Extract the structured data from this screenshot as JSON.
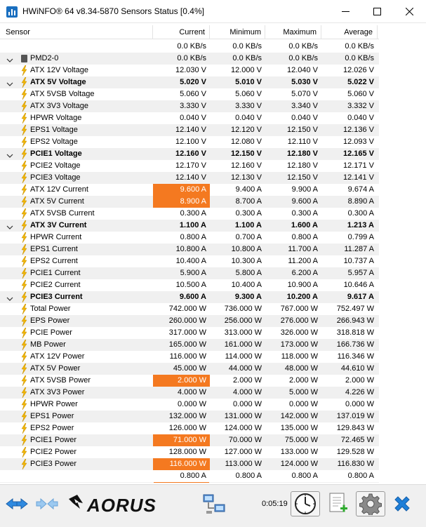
{
  "window": {
    "title": "HWiNFO® 64 v8.34-5870 Sensors Status [0.4%]"
  },
  "columns": {
    "sensor": "Sensor",
    "current": "Current",
    "minimum": "Minimum",
    "maximum": "Maximum",
    "average": "Average"
  },
  "rows": [
    {
      "type": "value",
      "label": "",
      "cur": "0.0 KB/s",
      "min": "0.0 KB/s",
      "max": "0.0 KB/s",
      "avg": "0.0 KB/s"
    },
    {
      "type": "device",
      "label": "PMD2-0",
      "cur": "0.0 KB/s",
      "min": "0.0 KB/s",
      "max": "0.0 KB/s",
      "avg": "0.0 KB/s"
    },
    {
      "type": "sensor",
      "label": "ATX 12V Voltage",
      "cur": "12.030 V",
      "min": "12.000 V",
      "max": "12.040 V",
      "avg": "12.026 V"
    },
    {
      "type": "group",
      "label": "ATX 5V Voltage",
      "cur": "5.020 V",
      "min": "5.010 V",
      "max": "5.030 V",
      "avg": "5.022 V"
    },
    {
      "type": "sensor",
      "label": "ATX 5VSB Voltage",
      "cur": "5.060 V",
      "min": "5.060 V",
      "max": "5.070 V",
      "avg": "5.060 V"
    },
    {
      "type": "sensor",
      "label": "ATX 3V3 Voltage",
      "cur": "3.330 V",
      "min": "3.330 V",
      "max": "3.340 V",
      "avg": "3.332 V"
    },
    {
      "type": "sensor",
      "label": "HPWR Voltage",
      "cur": "0.040 V",
      "min": "0.040 V",
      "max": "0.040 V",
      "avg": "0.040 V"
    },
    {
      "type": "sensor",
      "label": "EPS1 Voltage",
      "cur": "12.140 V",
      "min": "12.120 V",
      "max": "12.150 V",
      "avg": "12.136 V"
    },
    {
      "type": "sensor",
      "label": "EPS2 Voltage",
      "cur": "12.100 V",
      "min": "12.080 V",
      "max": "12.110 V",
      "avg": "12.093 V"
    },
    {
      "type": "group",
      "label": "PCIE1 Voltage",
      "cur": "12.160 V",
      "min": "12.150 V",
      "max": "12.180 V",
      "avg": "12.165 V"
    },
    {
      "type": "sensor",
      "label": "PCIE2 Voltage",
      "cur": "12.170 V",
      "min": "12.160 V",
      "max": "12.180 V",
      "avg": "12.171 V"
    },
    {
      "type": "sensor",
      "label": "PCIE3 Voltage",
      "cur": "12.140 V",
      "min": "12.130 V",
      "max": "12.150 V",
      "avg": "12.141 V"
    },
    {
      "type": "sensor",
      "label": "ATX 12V Current",
      "cur": "9.600 A",
      "min": "9.400 A",
      "max": "9.900 A",
      "avg": "9.674 A",
      "highlight": true
    },
    {
      "type": "sensor",
      "label": "ATX 5V Current",
      "cur": "8.900 A",
      "min": "8.700 A",
      "max": "9.600 A",
      "avg": "8.890 A",
      "highlight": true
    },
    {
      "type": "sensor",
      "label": "ATX 5VSB Current",
      "cur": "0.300 A",
      "min": "0.300 A",
      "max": "0.300 A",
      "avg": "0.300 A"
    },
    {
      "type": "group",
      "label": "ATX 3V Current",
      "cur": "1.100 A",
      "min": "1.100 A",
      "max": "1.600 A",
      "avg": "1.213 A"
    },
    {
      "type": "sensor",
      "label": "HPWR Current",
      "cur": "0.800 A",
      "min": "0.700 A",
      "max": "0.800 A",
      "avg": "0.799 A"
    },
    {
      "type": "sensor",
      "label": "EPS1 Current",
      "cur": "10.800 A",
      "min": "10.800 A",
      "max": "11.700 A",
      "avg": "11.287 A"
    },
    {
      "type": "sensor",
      "label": "EPS2 Current",
      "cur": "10.400 A",
      "min": "10.300 A",
      "max": "11.200 A",
      "avg": "10.737 A"
    },
    {
      "type": "sensor",
      "label": "PCIE1 Current",
      "cur": "5.900 A",
      "min": "5.800 A",
      "max": "6.200 A",
      "avg": "5.957 A"
    },
    {
      "type": "sensor",
      "label": "PCIE2 Current",
      "cur": "10.500 A",
      "min": "10.400 A",
      "max": "10.900 A",
      "avg": "10.646 A"
    },
    {
      "type": "group",
      "label": "PCIE3 Current",
      "cur": "9.600 A",
      "min": "9.300 A",
      "max": "10.200 A",
      "avg": "9.617 A"
    },
    {
      "type": "sensor",
      "label": "Total Power",
      "cur": "742.000 W",
      "min": "736.000 W",
      "max": "767.000 W",
      "avg": "752.497 W"
    },
    {
      "type": "sensor",
      "label": "EPS Power",
      "cur": "260.000 W",
      "min": "256.000 W",
      "max": "276.000 W",
      "avg": "266.943 W"
    },
    {
      "type": "sensor",
      "label": "PCIE Power",
      "cur": "317.000 W",
      "min": "313.000 W",
      "max": "326.000 W",
      "avg": "318.818 W"
    },
    {
      "type": "sensor",
      "label": "MB Power",
      "cur": "165.000 W",
      "min": "161.000 W",
      "max": "173.000 W",
      "avg": "166.736 W"
    },
    {
      "type": "sensor",
      "label": "ATX 12V Power",
      "cur": "116.000 W",
      "min": "114.000 W",
      "max": "118.000 W",
      "avg": "116.346 W"
    },
    {
      "type": "sensor",
      "label": "ATX 5V Power",
      "cur": "45.000 W",
      "min": "44.000 W",
      "max": "48.000 W",
      "avg": "44.610 W"
    },
    {
      "type": "sensor",
      "label": "ATX 5VSB Power",
      "cur": "2.000 W",
      "min": "2.000 W",
      "max": "2.000 W",
      "avg": "2.000 W",
      "highlight": true
    },
    {
      "type": "sensor",
      "label": "ATX 3V3 Power",
      "cur": "4.000 W",
      "min": "4.000 W",
      "max": "5.000 W",
      "avg": "4.226 W"
    },
    {
      "type": "sensor",
      "label": "HPWR Power",
      "cur": "0.000 W",
      "min": "0.000 W",
      "max": "0.000 W",
      "avg": "0.000 W"
    },
    {
      "type": "sensor",
      "label": "EPS1 Power",
      "cur": "132.000 W",
      "min": "131.000 W",
      "max": "142.000 W",
      "avg": "137.019 W"
    },
    {
      "type": "sensor",
      "label": "EPS2 Power",
      "cur": "126.000 W",
      "min": "124.000 W",
      "max": "135.000 W",
      "avg": "129.843 W"
    },
    {
      "type": "sensor",
      "label": "PCIE1 Power",
      "cur": "71.000 W",
      "min": "70.000 W",
      "max": "75.000 W",
      "avg": "72.465 W",
      "highlight": true
    },
    {
      "type": "sensor",
      "label": "PCIE2 Power",
      "cur": "128.000 W",
      "min": "127.000 W",
      "max": "133.000 W",
      "avg": "129.528 W"
    },
    {
      "type": "sensor",
      "label": "PCIE3 Power",
      "cur": "116.000 W",
      "min": "113.000 W",
      "max": "124.000 W",
      "avg": "116.830 W",
      "highlight": true
    },
    {
      "type": "value",
      "label": "",
      "cur": "0.800 A",
      "min": "0.800 A",
      "max": "0.800 A",
      "avg": "0.800 A"
    },
    {
      "type": "partial",
      "label": "",
      "cur": "",
      "min": "",
      "max": "",
      "avg": ""
    }
  ],
  "toolbar": {
    "elapsed_time": "0:05:19",
    "brand": "AORUS"
  },
  "colors": {
    "highlight": "#f47920",
    "sensor_icon": "#f2b600",
    "close_x": "#1e7fd8"
  }
}
